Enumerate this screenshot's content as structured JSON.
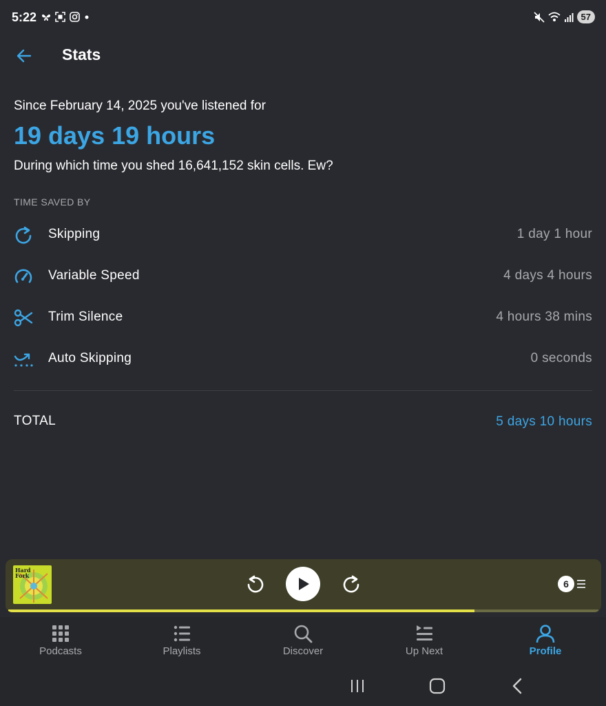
{
  "status_bar": {
    "time": "5:22",
    "battery": "57",
    "left_icons": [
      "butterfly-icon",
      "screenshot-icon",
      "instagram-icon",
      "dot-icon"
    ],
    "right_icons": [
      "mute-icon",
      "wifi-icon",
      "signal-icon"
    ]
  },
  "header": {
    "title": "Stats",
    "back_icon": "arrow-back-icon"
  },
  "summary": {
    "since": "Since February 14, 2025 you've listened for",
    "listened": "19 days 19 hours",
    "fun_fact": "During which time you shed 16,641,152 skin cells. Ew?"
  },
  "time_saved": {
    "section_label": "TIME SAVED BY",
    "rows": [
      {
        "label": "Skipping",
        "value": "1 day 1 hour",
        "icon": "skip-icon"
      },
      {
        "label": "Variable Speed",
        "value": "4 days 4 hours",
        "icon": "speedometer-icon"
      },
      {
        "label": "Trim Silence",
        "value": "4 hours 38 mins",
        "icon": "scissors-icon"
      },
      {
        "label": "Auto Skipping",
        "value": "0 seconds",
        "icon": "auto-skip-icon"
      }
    ],
    "total_label": "TOTAL",
    "total_value": "5 days 10 hours"
  },
  "mini_player": {
    "artwork_text": "Hard Fork",
    "up_next_count": "6",
    "progress": 0.79,
    "colors": {
      "background": "#3e3e29",
      "progress": "#e3e048"
    }
  },
  "bottom_nav": {
    "items": [
      {
        "label": "Podcasts",
        "icon": "grid-icon",
        "active": false
      },
      {
        "label": "Playlists",
        "icon": "list-icon",
        "active": false
      },
      {
        "label": "Discover",
        "icon": "search-icon",
        "active": false
      },
      {
        "label": "Up Next",
        "icon": "queue-icon",
        "active": false
      },
      {
        "label": "Profile",
        "icon": "person-icon",
        "active": true
      }
    ]
  },
  "colors": {
    "background": "#292a2f",
    "accent": "#3ca6e5",
    "muted_text": "#a7a9ad"
  }
}
